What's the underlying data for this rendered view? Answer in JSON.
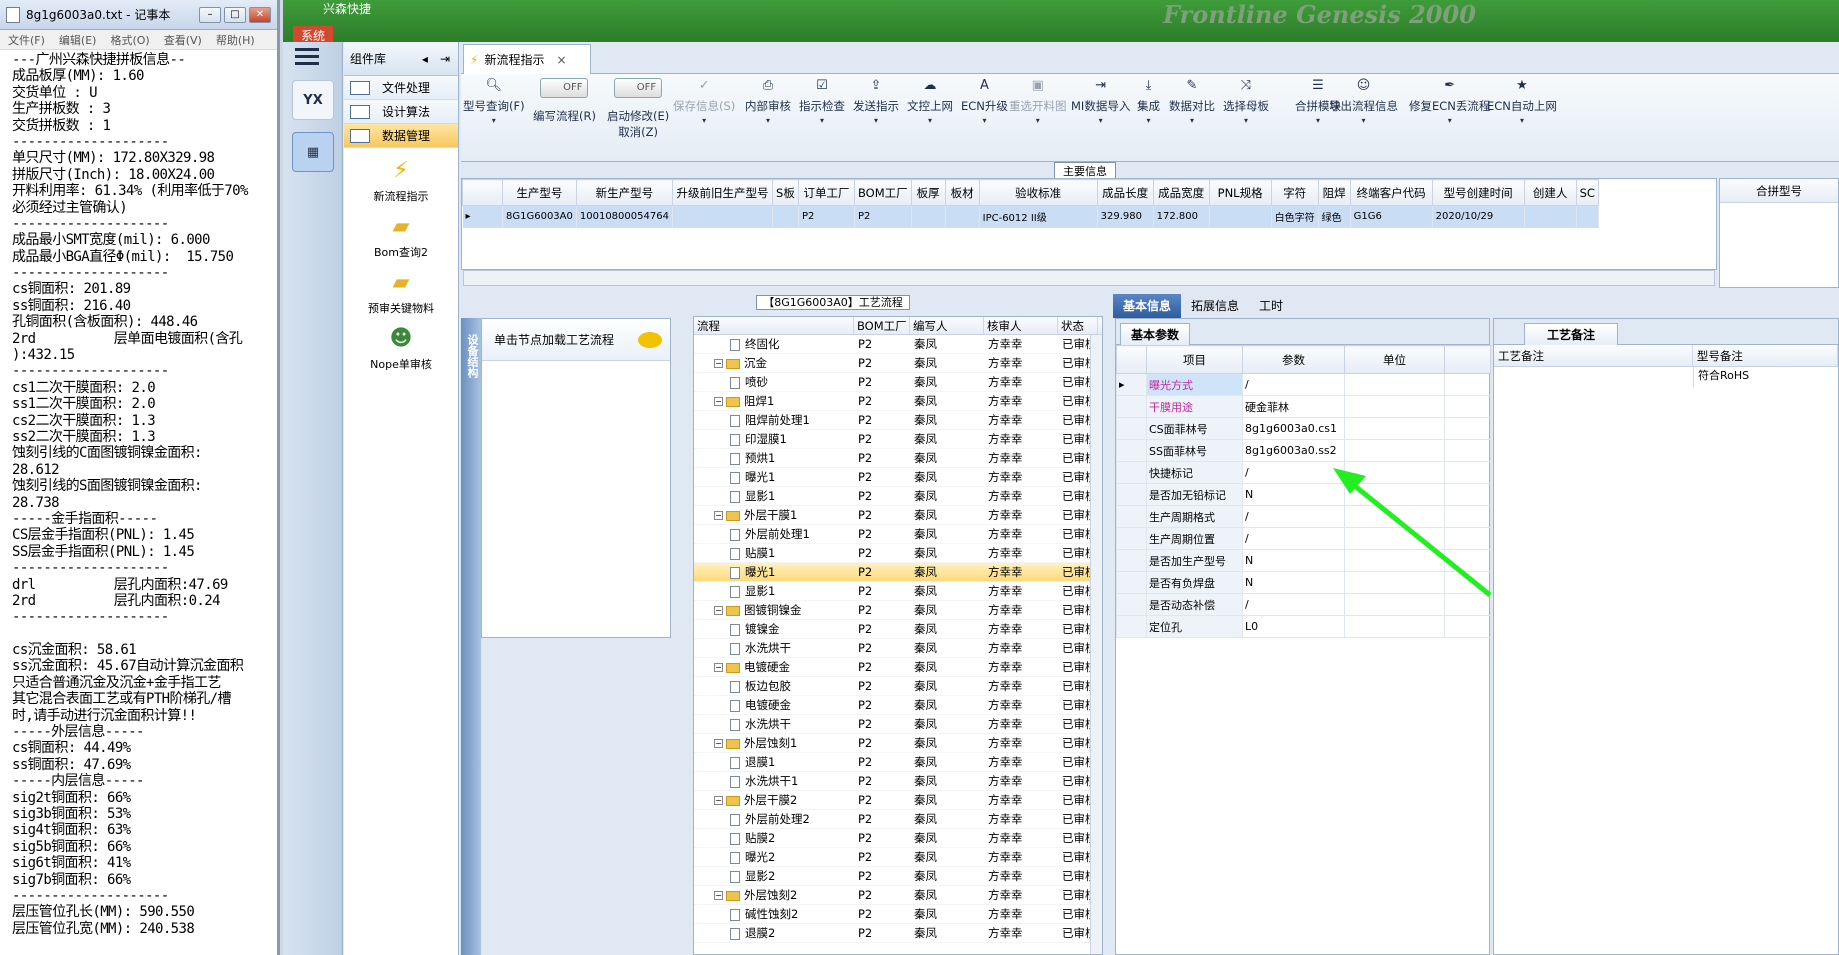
{
  "notepad": {
    "title": "8g1g6003a0.txt - 记事本",
    "menu": [
      "文件(F)",
      "编辑(E)",
      "格式(O)",
      "查看(V)",
      "帮助(H)"
    ],
    "lines": [
      "---广州兴森快捷拼板信息--",
      "成品板厚(MM): 1.60",
      "交货单位 : U",
      "生产拼板数 : 3",
      "交货拼板数 : 1",
      "--------------------",
      "单只尺寸(MM): 172.80X329.98",
      "拼版尺寸(Inch): 18.00X24.00",
      "开料利用率: 61.34% (利用率低于70%",
      "必须经过主管确认)",
      "--------------------",
      "成品最小SMT宽度(mil): 6.000",
      "成品最小BGA直径Φ(mil):  15.750",
      "--------------------",
      "cs铜面积: 201.89",
      "ss铜面积: 216.40",
      "孔铜面积(含板面积): 448.46",
      "2rd          层单面电镀面积(含孔",
      "):432.15",
      "--------------------",
      "cs1二次干膜面积: 2.0",
      "ss1二次干膜面积: 2.0",
      "cs2二次干膜面积: 1.3",
      "ss2二次干膜面积: 1.3",
      "蚀刻引线的C面图镀铜镍金面积:",
      "28.612",
      "蚀刻引线的S面图镀铜镍金面积:",
      "28.738",
      "-----金手指面积-----",
      "CS层金手指面积(PNL): 1.45",
      "SS层金手指面积(PNL): 1.45",
      "--------------------",
      "drl          层孔内面积:47.69",
      "2rd          层孔内面积:0.24",
      "--------------------",
      "",
      "cs沉金面积: 58.61",
      "ss沉金面积: 45.67自动计算沉金面积",
      "只适合普通沉金及沉金+金手指工艺",
      "其它混合表面工艺或有PTH阶梯孔/槽",
      "时,请手动进行沉金面积计算!!",
      "-----外层信息-----",
      "cs铜面积: 44.49%",
      "ss铜面积: 47.69%",
      "-----内层信息-----",
      "sig2t铜面积: 66%",
      "sig3b铜面积: 53%",
      "sig4t铜面积: 63%",
      "sig5b铜面积: 66%",
      "sig6t铜面积: 41%",
      "sig7b铜面积: 66%",
      "--------------------",
      "层压管位孔长(MM): 590.550",
      "层压管位孔宽(MM): 240.538"
    ]
  },
  "app": {
    "title": "兴森快捷",
    "system_tab": "系统",
    "ghost_text": "Frontline  Genesis 2000",
    "component_panel": {
      "title": "组件库",
      "items": [
        "文件处理",
        "设计算法",
        "数据管理"
      ],
      "tools": [
        "新流程指示",
        "Bom查询2",
        "预审关键物料",
        "Nope单审核"
      ]
    },
    "tab": {
      "label": "新流程指示",
      "close": "×"
    },
    "toolbar": [
      {
        "label": "型号查询(F)",
        "icon": "search-icon"
      },
      {
        "label": "编写流程(R)",
        "icon": "toggle",
        "toggle": "OFF"
      },
      {
        "label": "启动修改(E)",
        "sub": "取消(Z)",
        "icon": "toggle",
        "toggle": "OFF"
      },
      {
        "label": "保存信息(S)",
        "icon": "check-icon",
        "disabled": true
      },
      {
        "label": "内部审核",
        "icon": "printer-icon"
      },
      {
        "label": "指示检查",
        "icon": "checkbox-icon"
      },
      {
        "label": "发送指示",
        "icon": "upload-icon"
      },
      {
        "label": "文控上网",
        "icon": "cloud-upload-icon"
      },
      {
        "label": "ECN升级",
        "icon": "font-icon"
      },
      {
        "label": "重选开料图",
        "icon": "image-icon",
        "disabled": true
      },
      {
        "label": "MI数据导入",
        "icon": "signin-icon"
      },
      {
        "label": "集成",
        "icon": "download-icon"
      },
      {
        "label": "数据对比",
        "icon": "magic-icon"
      },
      {
        "label": "选择母板",
        "icon": "random-icon"
      },
      {
        "label": "合拼模块",
        "icon": "list-icon"
      },
      {
        "label": "导出流程信息",
        "icon": "smile-icon"
      },
      {
        "label": "修复ECN丢流程",
        "icon": "wrench-icon"
      },
      {
        "label": "ECN自动上网",
        "icon": "star-icon"
      }
    ],
    "main_info_label": "主要信息",
    "main_grid": {
      "columns": [
        "生产型号",
        "新生产型号",
        "升级前旧生产型号",
        "S板",
        "订单工厂",
        "BOM工厂",
        "板厚",
        "板材",
        "验收标准",
        "成品长度",
        "成品宽度",
        "PNL规格",
        "字符",
        "阻焊",
        "终端客户代码",
        "型号创建时间",
        "创建人",
        "SC"
      ],
      "rows": [
        [
          "8G1G6003A0",
          "10010800054764",
          "",
          "",
          "P2",
          "P2",
          "",
          "",
          "IPC-6012 II级",
          "329.980",
          "172.800",
          "",
          "白色字符",
          "绿色",
          "G1G6",
          "2020/10/29",
          "",
          ""
        ]
      ]
    },
    "merge_panel": {
      "title": "合拼型号"
    },
    "side_tab": "设备结构",
    "hint": "单击节点加载工艺流程",
    "flow": {
      "title": "【8G1G6003A0】工艺流程",
      "columns": [
        "流程",
        "BOM工厂",
        "编写人",
        "核审人",
        "状态"
      ],
      "rows": [
        {
          "name": "终固化",
          "level": 2,
          "folder": false,
          "bom": "P2",
          "writer": "秦凤",
          "reviewer": "方幸幸",
          "status": "已审核"
        },
        {
          "name": "沉金",
          "level": 1,
          "folder": true,
          "bom": "P2",
          "writer": "秦凤",
          "reviewer": "方幸幸",
          "status": "已审核"
        },
        {
          "name": "喷砂",
          "level": 2,
          "folder": false,
          "bom": "P2",
          "writer": "秦凤",
          "reviewer": "方幸幸",
          "status": "已审核"
        },
        {
          "name": "阻焊1",
          "level": 1,
          "folder": true,
          "bom": "P2",
          "writer": "秦凤",
          "reviewer": "方幸幸",
          "status": "已审核"
        },
        {
          "name": "阻焊前处理1",
          "level": 2,
          "folder": false,
          "bom": "P2",
          "writer": "秦凤",
          "reviewer": "方幸幸",
          "status": "已审核"
        },
        {
          "name": "印湿膜1",
          "level": 2,
          "folder": false,
          "bom": "P2",
          "writer": "秦凤",
          "reviewer": "方幸幸",
          "status": "已审核"
        },
        {
          "name": "预烘1",
          "level": 2,
          "folder": false,
          "bom": "P2",
          "writer": "秦凤",
          "reviewer": "方幸幸",
          "status": "已审核"
        },
        {
          "name": "曝光1",
          "level": 2,
          "folder": false,
          "bom": "P2",
          "writer": "秦凤",
          "reviewer": "方幸幸",
          "status": "已审核"
        },
        {
          "name": "显影1",
          "level": 2,
          "folder": false,
          "bom": "P2",
          "writer": "秦凤",
          "reviewer": "方幸幸",
          "status": "已审核"
        },
        {
          "name": "外层干膜1",
          "level": 1,
          "folder": true,
          "bom": "P2",
          "writer": "秦凤",
          "reviewer": "方幸幸",
          "status": "已审核"
        },
        {
          "name": "外层前处理1",
          "level": 2,
          "folder": false,
          "bom": "P2",
          "writer": "秦凤",
          "reviewer": "方幸幸",
          "status": "已审核"
        },
        {
          "name": "贴膜1",
          "level": 2,
          "folder": false,
          "bom": "P2",
          "writer": "秦凤",
          "reviewer": "方幸幸",
          "status": "已审核"
        },
        {
          "name": "曝光1",
          "level": 2,
          "folder": false,
          "bom": "P2",
          "writer": "秦凤",
          "reviewer": "方幸幸",
          "status": "已审核",
          "highlight": true
        },
        {
          "name": "显影1",
          "level": 2,
          "folder": false,
          "bom": "P2",
          "writer": "秦凤",
          "reviewer": "方幸幸",
          "status": "已审核"
        },
        {
          "name": "图镀铜镍金",
          "level": 1,
          "folder": true,
          "bom": "P2",
          "writer": "秦凤",
          "reviewer": "方幸幸",
          "status": "已审核"
        },
        {
          "name": "镀镍金",
          "level": 2,
          "folder": false,
          "bom": "P2",
          "writer": "秦凤",
          "reviewer": "方幸幸",
          "status": "已审核"
        },
        {
          "name": "水洗烘干",
          "level": 2,
          "folder": false,
          "bom": "P2",
          "writer": "秦凤",
          "reviewer": "方幸幸",
          "status": "已审核"
        },
        {
          "name": "电镀硬金",
          "level": 1,
          "folder": true,
          "bom": "P2",
          "writer": "秦凤",
          "reviewer": "方幸幸",
          "status": "已审核"
        },
        {
          "name": "板边包胶",
          "level": 2,
          "folder": false,
          "bom": "P2",
          "writer": "秦凤",
          "reviewer": "方幸幸",
          "status": "已审核"
        },
        {
          "name": "电镀硬金",
          "level": 2,
          "folder": false,
          "bom": "P2",
          "writer": "秦凤",
          "reviewer": "方幸幸",
          "status": "已审核"
        },
        {
          "name": "水洗烘干",
          "level": 2,
          "folder": false,
          "bom": "P2",
          "writer": "秦凤",
          "reviewer": "方幸幸",
          "status": "已审核"
        },
        {
          "name": "外层蚀刻1",
          "level": 1,
          "folder": true,
          "bom": "P2",
          "writer": "秦凤",
          "reviewer": "方幸幸",
          "status": "已审核"
        },
        {
          "name": "退膜1",
          "level": 2,
          "folder": false,
          "bom": "P2",
          "writer": "秦凤",
          "reviewer": "方幸幸",
          "status": "已审核"
        },
        {
          "name": "水洗烘干1",
          "level": 2,
          "folder": false,
          "bom": "P2",
          "writer": "秦凤",
          "reviewer": "方幸幸",
          "status": "已审核"
        },
        {
          "name": "外层干膜2",
          "level": 1,
          "folder": true,
          "bom": "P2",
          "writer": "秦凤",
          "reviewer": "方幸幸",
          "status": "已审核"
        },
        {
          "name": "外层前处理2",
          "level": 2,
          "folder": false,
          "bom": "P2",
          "writer": "秦凤",
          "reviewer": "方幸幸",
          "status": "已审核"
        },
        {
          "name": "贴膜2",
          "level": 2,
          "folder": false,
          "bom": "P2",
          "writer": "秦凤",
          "reviewer": "方幸幸",
          "status": "已审核"
        },
        {
          "name": "曝光2",
          "level": 2,
          "folder": false,
          "bom": "P2",
          "writer": "秦凤",
          "reviewer": "方幸幸",
          "status": "已审核"
        },
        {
          "name": "显影2",
          "level": 2,
          "folder": false,
          "bom": "P2",
          "writer": "秦凤",
          "reviewer": "方幸幸",
          "status": "已审核"
        },
        {
          "name": "外层蚀刻2",
          "level": 1,
          "folder": true,
          "bom": "P2",
          "writer": "秦凤",
          "reviewer": "方幸幸",
          "status": "已审核"
        },
        {
          "name": "碱性蚀刻2",
          "level": 2,
          "folder": false,
          "bom": "P2",
          "writer": "秦凤",
          "reviewer": "方幸幸",
          "status": "已审核"
        },
        {
          "name": "退膜2",
          "level": 2,
          "folder": false,
          "bom": "P2",
          "writer": "秦凤",
          "reviewer": "方幸幸",
          "status": "已审核"
        }
      ]
    },
    "right_tabs": [
      "基本信息",
      "拓展信息",
      "工时"
    ],
    "basic": {
      "title": "基本参数",
      "columns": [
        "项目",
        "参数",
        "单位"
      ],
      "rows": [
        {
          "k": "曝光方式",
          "v": "/",
          "pink": true,
          "current": true
        },
        {
          "k": "干膜用途",
          "v": "硬金菲林",
          "pink": true
        },
        {
          "k": "CS面菲林号",
          "v": "8g1g6003a0.cs1"
        },
        {
          "k": "SS面菲林号",
          "v": "8g1g6003a0.ss2"
        },
        {
          "k": "快捷标记",
          "v": "/"
        },
        {
          "k": "是否加无铅标记",
          "v": "N"
        },
        {
          "k": "生产周期格式",
          "v": "/"
        },
        {
          "k": "生产周期位置",
          "v": "/"
        },
        {
          "k": "是否加生产型号",
          "v": "N"
        },
        {
          "k": "是否有负焊盘",
          "v": "N"
        },
        {
          "k": "是否动态补偿",
          "v": "/"
        },
        {
          "k": "定位孔",
          "v": "L0"
        }
      ]
    },
    "craft": {
      "title": "工艺备注",
      "columns": [
        "工艺备注",
        "型号备注"
      ],
      "model_note": "符合RoHS"
    },
    "colors": {
      "accent": "#2d5d9e",
      "highlight": "#ffd97a",
      "arrow": "#22ee22"
    }
  }
}
